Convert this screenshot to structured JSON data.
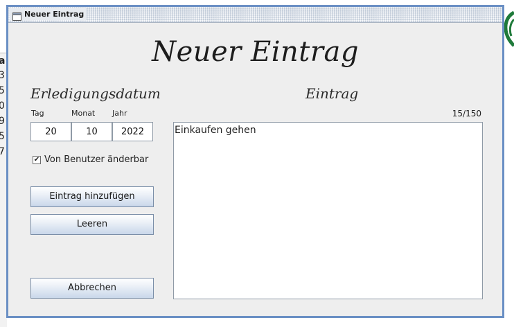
{
  "window": {
    "title": "Neuer Eintrag"
  },
  "dialog": {
    "heading": "Neuer Eintrag",
    "date_section_title": "Erledigungsdatum",
    "entry_section_title": "Eintrag",
    "labels": {
      "day": "Tag",
      "month": "Monat",
      "year": "Jahr"
    },
    "date": {
      "day": "20",
      "month": "10",
      "year": "2022"
    },
    "checkbox": {
      "label": "Von Benutzer änderbar",
      "checked": true,
      "mark": "✔"
    },
    "buttons": {
      "add": "Eintrag hinzufügen",
      "clear": "Leeren",
      "cancel": "Abbrechen"
    },
    "entry": {
      "text": "Einkaufen gehen",
      "counter": "15/150"
    }
  },
  "background_app": {
    "visible_row_fragments": [
      "a",
      "3",
      "5",
      "0",
      "9",
      "5",
      "7"
    ]
  },
  "colors": {
    "window_border": "#6a8fc4",
    "dialog_background": "#eeeeee",
    "button_gradient_bottom": "#c9d7ea",
    "logo_green": "#1f7a3a"
  }
}
